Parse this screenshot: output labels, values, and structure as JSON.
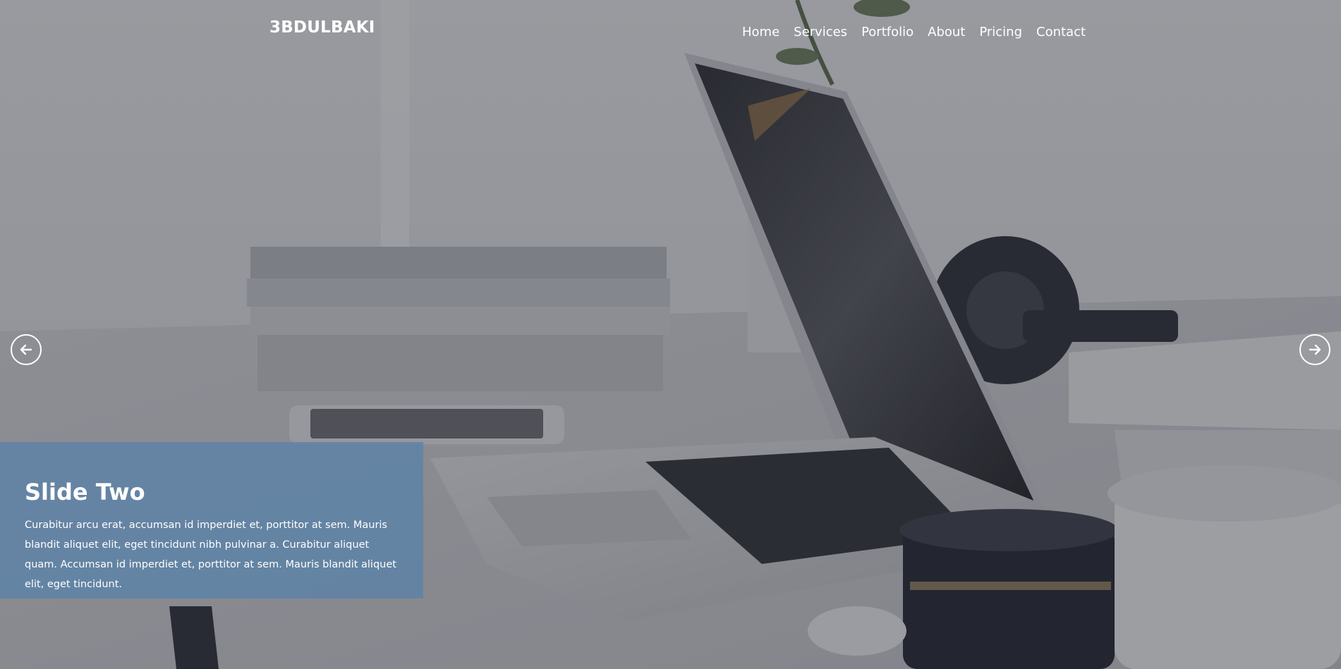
{
  "brand": {
    "name": "3BDULBAKI"
  },
  "nav": {
    "items": [
      {
        "label": "Home"
      },
      {
        "label": "Services"
      },
      {
        "label": "Portfolio"
      },
      {
        "label": "About"
      },
      {
        "label": "Pricing"
      },
      {
        "label": "Contact"
      }
    ]
  },
  "slider": {
    "prev_icon": "arrow-left-icon",
    "next_icon": "arrow-right-icon",
    "caption": {
      "title": "Slide Two",
      "text": "Curabitur arcu erat, accumsan id imperdiet et, porttitor at sem. Mauris blandit aliquet elit, eget tincidunt nibh pulvinar a. Curabitur aliquet quam. Accumsan id imperdiet et, porttitor at sem. Mauris blandit aliquet elit, eget tincidunt."
    }
  },
  "colors": {
    "caption_bg": "#5882aa",
    "overlay": "#282a34",
    "text": "#ffffff"
  }
}
